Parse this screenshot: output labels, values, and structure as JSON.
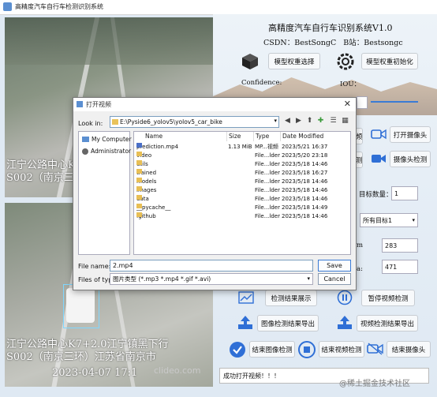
{
  "window": {
    "title": "高精度汽车自行车检测识别系统"
  },
  "app": {
    "system_title": "高精度汽车自行车识别系统V1.0",
    "csdn_label": "CSDN：",
    "csdn_value": "BestSongC",
    "bilibili_label": "B站：",
    "bilibili_value": "Bestsongc",
    "select_weights": "模型权重选择",
    "init_weights": "模型权重初始化",
    "confidence_label": "Confidence:",
    "iou_label": "IOU：",
    "open_camera": "打开摄像头",
    "camera_detect": "摄像头检测",
    "target_count_label": "目标数量：",
    "target_count_value": "1",
    "target_select": "所有目标1",
    "value_a": "283",
    "value_b": "471",
    "show_results": "检测结果展示",
    "pause_video": "暂停视频检测",
    "export_image_result": "图像检测结果导出",
    "export_video_result": "视频检测结果导出",
    "end_image_detect": "结束图像检测",
    "end_video_detect": "结束视频检测",
    "end_camera": "结束摄像头",
    "partial_btn_1": "频",
    "partial_btn_2": "测",
    "partial_label_1": "m",
    "partial_label_2": "a:",
    "status_text": "成功打开视频！！！"
  },
  "video_overlay": {
    "top_line1": "江宁公路中心K7",
    "top_line2": "S002（南京三环",
    "bottom_line1": "江宁公路中心K7+2.0江宁镇黑下行",
    "bottom_line2": "S002（南京三环）江苏省南京市",
    "bottom_line3": "2023-04-07 17:1",
    "watermark": "clideo.com"
  },
  "dialog": {
    "title": "打开视频",
    "look_in_label": "Look in:",
    "path": "E:\\Pyside6_yolov5\\yolov5_car_bike",
    "sidebar": [
      {
        "label": "My Computer",
        "icon": "computer-icon"
      },
      {
        "label": "Administrator",
        "icon": "user-icon"
      }
    ],
    "columns": [
      "Name",
      "Size",
      "Type",
      "Date Modified"
    ],
    "files": [
      {
        "name": "prediction.mp4",
        "size": "1.13 MiB",
        "type": "MP...视频",
        "date": "2023/5/21 16:37",
        "kind": "mp4"
      },
      {
        "name": "video",
        "size": "",
        "type": "File...lder",
        "date": "2023/5/20 23:18",
        "kind": "folder"
      },
      {
        "name": "utils",
        "size": "",
        "type": "File...lder",
        "date": "2023/5/18 14:46",
        "kind": "folder"
      },
      {
        "name": "trained",
        "size": "",
        "type": "File...lder",
        "date": "2023/5/18 16:27",
        "kind": "folder"
      },
      {
        "name": "models",
        "size": "",
        "type": "File...lder",
        "date": "2023/5/18 14:46",
        "kind": "folder"
      },
      {
        "name": "images",
        "size": "",
        "type": "File...lder",
        "date": "2023/5/18 14:46",
        "kind": "folder"
      },
      {
        "name": "data",
        "size": "",
        "type": "File...lder",
        "date": "2023/5/18 14:46",
        "kind": "folder"
      },
      {
        "name": "__pycache__",
        "size": "",
        "type": "File...lder",
        "date": "2023/5/18 14:49",
        "kind": "folder"
      },
      {
        "name": ".github",
        "size": "",
        "type": "File...lder",
        "date": "2023/5/18 14:46",
        "kind": "folder"
      }
    ],
    "filename_label": "File name:",
    "filename_value": "2.mp4",
    "filetype_label": "Files of type:",
    "filetype_value": "图片类型 (*.mp3 *.mp4 *.gif *.avi)",
    "save_label": "Save",
    "cancel_label": "Cancel"
  },
  "site_watermark": "@稀土掘金技术社区",
  "colors": {
    "accent": "#2f6fd6",
    "status_bg": "#ffffff"
  }
}
